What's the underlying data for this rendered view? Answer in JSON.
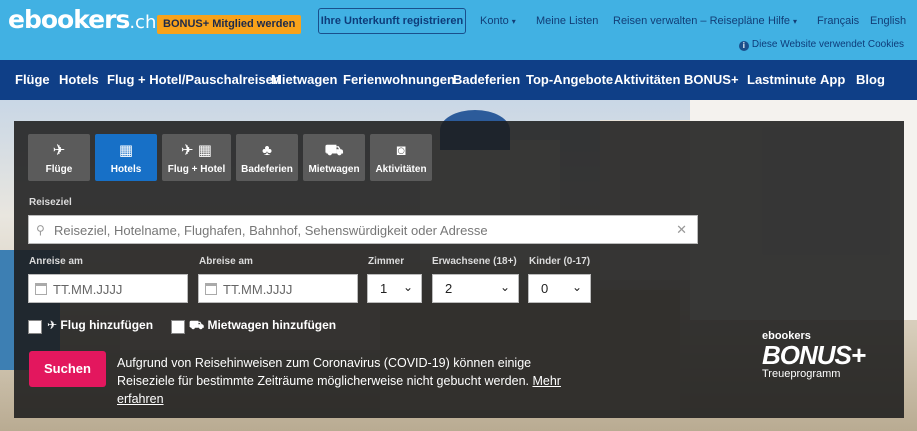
{
  "header": {
    "logo_main": "ebookers",
    "logo_tld": ".ch",
    "bonus_badge": "BONUS+ Mitglied werden",
    "register_button": "Ihre Unterkunft registrieren",
    "links": {
      "account": "Konto",
      "lists": "Meine Listen",
      "manage": "Reisen verwalten – Reisepläne",
      "help": "Hilfe",
      "lang_fr": "Français",
      "lang_en": "English"
    },
    "cookie_notice": "Diese Website verwendet Cookies"
  },
  "nav": {
    "items": [
      "Flüge",
      "Hotels",
      "Flug + Hotel/Pauschalreisen",
      "Mietwagen",
      "Ferienwohnungen",
      "Badeferien",
      "Top-Angebote",
      "Aktivitäten",
      "BONUS+",
      "Lastminute",
      "App",
      "Blog"
    ]
  },
  "search": {
    "tabs": [
      {
        "label": "Flüge",
        "icon": "plane-icon"
      },
      {
        "label": "Hotels",
        "icon": "hotel-icon"
      },
      {
        "label": "Flug + Hotel",
        "icon": "plane-hotel-icon"
      },
      {
        "label": "Badeferien",
        "icon": "palm-icon"
      },
      {
        "label": "Mietwagen",
        "icon": "car-icon"
      },
      {
        "label": "Aktivitäten",
        "icon": "camera-icon"
      }
    ],
    "active_tab": "Hotels",
    "destination_label": "Reiseziel",
    "destination_placeholder": "Reiseziel, Hotelname, Flughafen, Bahnhof, Sehenswürdigkeit oder Adresse",
    "checkin_label": "Anreise am",
    "checkin_placeholder": "TT.MM.JJJJ",
    "checkout_label": "Abreise am",
    "checkout_placeholder": "TT.MM.JJJJ",
    "rooms_label": "Zimmer",
    "rooms_value": "1",
    "adults_label": "Erwachsene (18+)",
    "adults_value": "2",
    "children_label": "Kinder (0-17)",
    "children_value": "0",
    "add_flight": "Flug hinzufügen",
    "add_car": "Mietwagen hinzufügen",
    "search_button": "Suchen",
    "covid_notice": "Aufgrund von Reisehinweisen zum Coronavirus (COVID-19) können einige Reiseziele für bestimmte Zeiträume möglicherweise nicht gebucht werden.",
    "covid_link": "Mehr erfahren"
  },
  "bonus_logo": {
    "small": "ebookers",
    "big": "BONUS+",
    "sub": "Treueprogramm"
  },
  "colors": {
    "header_bg": "#41b1e3",
    "nav_bg": "#0f3f87",
    "active_tab": "#1770c7",
    "search_button": "#e3175e",
    "badge": "#f8a21a"
  }
}
